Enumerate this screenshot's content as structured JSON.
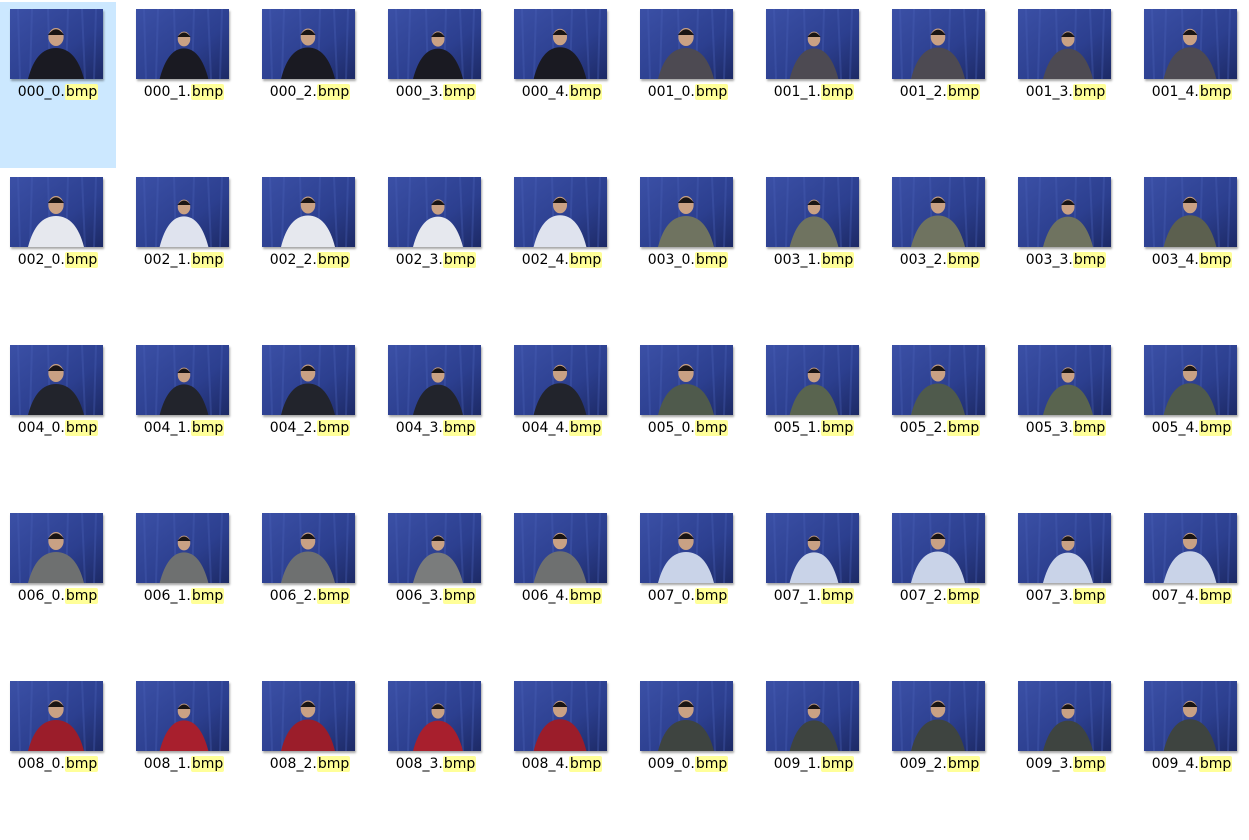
{
  "colors": {
    "selection": "#cce8ff",
    "highlight": "#ffff99",
    "backdrop": "#2c3f8f"
  },
  "search_highlight": "bmp",
  "selected_index": 0,
  "files": [
    {
      "base": "000_0.",
      "ext": "bmp",
      "shirt": "#1a1a22"
    },
    {
      "base": "000_1.",
      "ext": "bmp",
      "shirt": "#1a1a22"
    },
    {
      "base": "000_2.",
      "ext": "bmp",
      "shirt": "#1a1a22"
    },
    {
      "base": "000_3.",
      "ext": "bmp",
      "shirt": "#1a1a22"
    },
    {
      "base": "000_4.",
      "ext": "bmp",
      "shirt": "#1a1a22"
    },
    {
      "base": "001_0.",
      "ext": "bmp",
      "shirt": "#4d4a52"
    },
    {
      "base": "001_1.",
      "ext": "bmp",
      "shirt": "#4d4a52"
    },
    {
      "base": "001_2.",
      "ext": "bmp",
      "shirt": "#4d4a52"
    },
    {
      "base": "001_3.",
      "ext": "bmp",
      "shirt": "#4d4a52"
    },
    {
      "base": "001_4.",
      "ext": "bmp",
      "shirt": "#4d4a52"
    },
    {
      "base": "002_0.",
      "ext": "bmp",
      "shirt": "#e6e8ee"
    },
    {
      "base": "002_1.",
      "ext": "bmp",
      "shirt": "#dfe3ee"
    },
    {
      "base": "002_2.",
      "ext": "bmp",
      "shirt": "#e6e8ee"
    },
    {
      "base": "002_3.",
      "ext": "bmp",
      "shirt": "#e6e8ee"
    },
    {
      "base": "002_4.",
      "ext": "bmp",
      "shirt": "#dfe3ee"
    },
    {
      "base": "003_0.",
      "ext": "bmp",
      "shirt": "#6f7360"
    },
    {
      "base": "003_1.",
      "ext": "bmp",
      "shirt": "#6f7360"
    },
    {
      "base": "003_2.",
      "ext": "bmp",
      "shirt": "#6f7360"
    },
    {
      "base": "003_3.",
      "ext": "bmp",
      "shirt": "#6f7360"
    },
    {
      "base": "003_4.",
      "ext": "bmp",
      "shirt": "#5c604f"
    },
    {
      "base": "004_0.",
      "ext": "bmp",
      "shirt": "#22242c"
    },
    {
      "base": "004_1.",
      "ext": "bmp",
      "shirt": "#22242c"
    },
    {
      "base": "004_2.",
      "ext": "bmp",
      "shirt": "#22242c"
    },
    {
      "base": "004_3.",
      "ext": "bmp",
      "shirt": "#22242c"
    },
    {
      "base": "004_4.",
      "ext": "bmp",
      "shirt": "#22242c"
    },
    {
      "base": "005_0.",
      "ext": "bmp",
      "shirt": "#4f5a4c"
    },
    {
      "base": "005_1.",
      "ext": "bmp",
      "shirt": "#59644f"
    },
    {
      "base": "005_2.",
      "ext": "bmp",
      "shirt": "#4f5a4c"
    },
    {
      "base": "005_3.",
      "ext": "bmp",
      "shirt": "#59644f"
    },
    {
      "base": "005_4.",
      "ext": "bmp",
      "shirt": "#4f5a4c"
    },
    {
      "base": "006_0.",
      "ext": "bmp",
      "shirt": "#6e7070"
    },
    {
      "base": "006_1.",
      "ext": "bmp",
      "shirt": "#6e7070"
    },
    {
      "base": "006_2.",
      "ext": "bmp",
      "shirt": "#6e7070"
    },
    {
      "base": "006_3.",
      "ext": "bmp",
      "shirt": "#7a7c7c"
    },
    {
      "base": "006_4.",
      "ext": "bmp",
      "shirt": "#6e7070"
    },
    {
      "base": "007_0.",
      "ext": "bmp",
      "shirt": "#c9d3e8"
    },
    {
      "base": "007_1.",
      "ext": "bmp",
      "shirt": "#c9d3e8"
    },
    {
      "base": "007_2.",
      "ext": "bmp",
      "shirt": "#c9d3e8"
    },
    {
      "base": "007_3.",
      "ext": "bmp",
      "shirt": "#c9d3e8"
    },
    {
      "base": "007_4.",
      "ext": "bmp",
      "shirt": "#c9d3e8"
    },
    {
      "base": "008_0.",
      "ext": "bmp",
      "shirt": "#9b1d2a"
    },
    {
      "base": "008_1.",
      "ext": "bmp",
      "shirt": "#a81f2d"
    },
    {
      "base": "008_2.",
      "ext": "bmp",
      "shirt": "#9b1d2a"
    },
    {
      "base": "008_3.",
      "ext": "bmp",
      "shirt": "#a81f2d"
    },
    {
      "base": "008_4.",
      "ext": "bmp",
      "shirt": "#9b1d2a"
    },
    {
      "base": "009_0.",
      "ext": "bmp",
      "shirt": "#3e4440"
    },
    {
      "base": "009_1.",
      "ext": "bmp",
      "shirt": "#3e4440"
    },
    {
      "base": "009_2.",
      "ext": "bmp",
      "shirt": "#3e4440"
    },
    {
      "base": "009_3.",
      "ext": "bmp",
      "shirt": "#3e4440"
    },
    {
      "base": "009_4.",
      "ext": "bmp",
      "shirt": "#3e4440"
    }
  ]
}
